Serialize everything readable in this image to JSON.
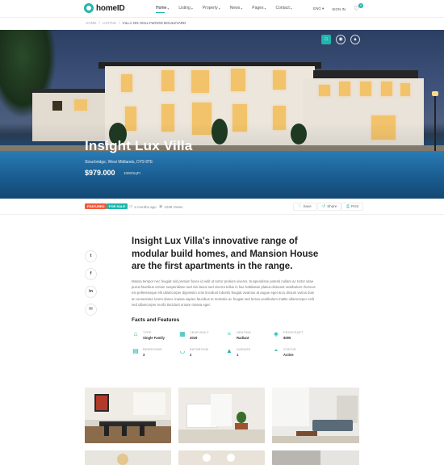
{
  "brand": {
    "name": "homeID",
    "accent": "#1fb6ad",
    "featured_color": "#f25a3c"
  },
  "nav": {
    "links": [
      {
        "label": "Home",
        "active": true
      },
      {
        "label": "Listing"
      },
      {
        "label": "Property"
      },
      {
        "label": "News"
      },
      {
        "label": "Pages"
      },
      {
        "label": "Contact"
      }
    ],
    "language": "ENG",
    "signin": "SIGN IN",
    "wishlist_count": "0"
  },
  "breadcrumb": [
    "HOME",
    "LISTING",
    "VILLA ON HOLLYWOOD BOULEVARD"
  ],
  "hero": {
    "tools": [
      "image-icon",
      "map-pin-icon",
      "location-icon"
    ],
    "title": "Insight Lux Villa",
    "address": "Stourbridge, West Midlands, DY9 8TE",
    "price": "$979.000",
    "price_unit": "1000/SqFt"
  },
  "meta": {
    "tags": [
      "FEATURED",
      "FOR SALE"
    ],
    "posted": "2 months ago",
    "views": "1039 Views",
    "actions": [
      "Save",
      "Share",
      "Print"
    ]
  },
  "share": [
    "twitter-icon",
    "facebook-icon",
    "linkedin-icon",
    "email-icon"
  ],
  "description": {
    "headline": "Insight Lux Villa's innovative range of modular build homes, and Mansion House are the first apartments in the range.",
    "body": "Massa tempor nec feugiat nisl pretium fusce id velit ut tortor pretium viverra. Suspendisse potenti nullam ac tortor vitae purus faucibus ornare suspendisse sed nisi lacus sed viverra tellus in hac habitasse platea dictumst vestibulum rhoncus est pellentesque elit ullamcorper dignissim cras tincidunt lobortis feugiat vivamus at augue eget arcu dictum varius duis at consectetur lorem donec massa sapien faucibus et molestie ac feugiat sed lectus vestibulum mattis ullamcorper velit sed ullamcorper morbi tincidunt ornare massa eget."
  },
  "facts": {
    "title": "Facts and Features",
    "items": [
      {
        "label": "TYPE",
        "value": "Single Family",
        "icon": "house-icon"
      },
      {
        "label": "YEAR BUILT",
        "value": "2019",
        "icon": "calendar-icon"
      },
      {
        "label": "HEATING",
        "value": "Radiant",
        "icon": "heating-icon"
      },
      {
        "label": "PRICE/SQFT",
        "value": "$095",
        "icon": "price-tag-icon"
      },
      {
        "label": "BEDROOMS",
        "value": "3",
        "icon": "bed-icon"
      },
      {
        "label": "BATHROOM",
        "value": "2",
        "icon": "bath-icon"
      },
      {
        "label": "GARAGE",
        "value": "1",
        "icon": "garage-icon"
      },
      {
        "label": "STATUS",
        "value": "Active",
        "icon": "status-icon"
      }
    ]
  }
}
